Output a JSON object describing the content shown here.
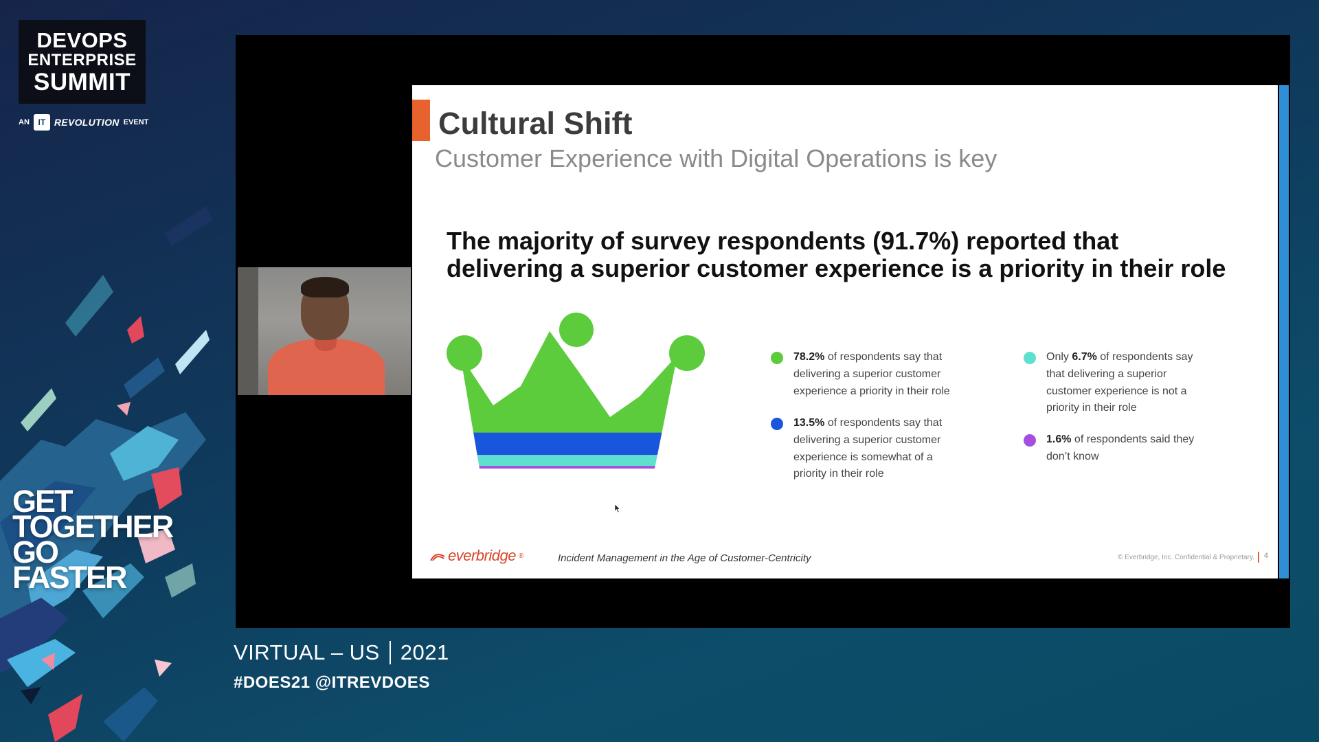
{
  "branding": {
    "logo_line1": "DEVOPS",
    "logo_line2": "ENTERPRISE",
    "logo_line3": "SUMMIT",
    "an_label": "AN",
    "rev_mark": "IT",
    "revolution_label": "REVOLUTION",
    "event_label": "EVENT"
  },
  "tagline": {
    "line1": "GET",
    "line2": "TOGETHER",
    "line3": "GO",
    "line4": "FASTER"
  },
  "event": {
    "location": "VIRTUAL – US",
    "year": "2021",
    "hashtags": "#DOES21 @ITREVDOES"
  },
  "slide": {
    "title": "Cultural Shift",
    "subtitle": "Customer Experience with Digital Operations is key",
    "headline_line1": "The majority of survey respondents (91.7%) reported that",
    "headline_line2": "delivering a superior customer experience is a priority in their role",
    "legend": [
      {
        "value": "78.2%",
        "prefix": "",
        "text": " of respondents say that delivering a superior customer experience a priority in their role",
        "color": "#5ccb3c"
      },
      {
        "value": "13.5%",
        "prefix": "",
        "text": " of respondents say that delivering a superior customer experience is somewhat of a priority in their role",
        "color": "#1a56db"
      },
      {
        "value": "6.7%",
        "prefix": "Only ",
        "text": " of respondents say that delivering a superior customer experience is not a priority in their role",
        "color": "#5fe0cf"
      },
      {
        "value": "1.6%",
        "prefix": "",
        "text": " of respondents said they don’t know",
        "color": "#a64ee0"
      }
    ],
    "footer_brand": "everbridge",
    "footer_registered": "®",
    "footer_center": "Incident Management in the Age of Customer-Centricity",
    "footer_right": "© Everbridge, Inc. Confidential & Proprietary.",
    "page_number": "4"
  },
  "chart_data": {
    "type": "stacked-bar",
    "categories": [
      "Priority",
      "Somewhat of a priority",
      "Not a priority",
      "Don't know"
    ],
    "values": [
      78.2,
      13.5,
      6.7,
      1.6
    ],
    "colors": [
      "#5ccb3c",
      "#1a56db",
      "#5fe0cf",
      "#a64ee0"
    ]
  },
  "colors": {
    "accent_orange": "#e8622d",
    "slide_right_bar": "#2e8fd6"
  }
}
